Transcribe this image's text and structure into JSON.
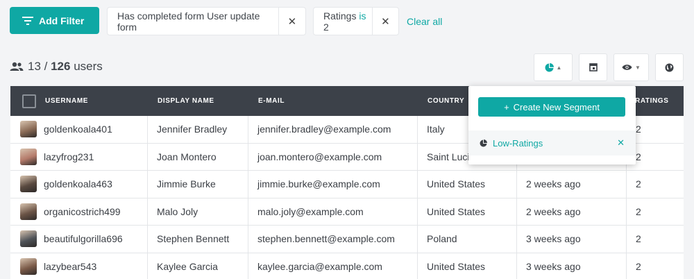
{
  "filters": {
    "add_filter_label": "Add Filter",
    "chips": [
      {
        "text_a": "Has completed form User update form",
        "hl": "",
        "text_b": ""
      },
      {
        "text_a": "Ratings ",
        "hl": "is",
        "text_b": " 2"
      }
    ],
    "clear_all_label": "Clear all"
  },
  "summary": {
    "shown": "13",
    "separator": " / ",
    "total": "126",
    "suffix": " users"
  },
  "toolbar": {
    "icons": [
      "segment-pie-icon",
      "columns-icon",
      "eye-icon",
      "globe-icon"
    ]
  },
  "table": {
    "headers": [
      "USERNAME",
      "DISPLAY NAME",
      "E-MAIL",
      "COUNTRY",
      "",
      "RATINGS"
    ],
    "rows": [
      {
        "username": "goldenkoala401",
        "display": "Jennifer Bradley",
        "email": "jennifer.bradley@example.com",
        "country": "Italy",
        "time": "",
        "rating": "2",
        "avatar": "#8a6a55"
      },
      {
        "username": "lazyfrog231",
        "display": "Joan Montero",
        "email": "joan.montero@example.com",
        "country": "Saint Lucia",
        "time": "",
        "rating": "2",
        "avatar": "#b47a6a"
      },
      {
        "username": "goldenkoala463",
        "display": "Jimmie Burke",
        "email": "jimmie.burke@example.com",
        "country": "United States",
        "time": "2 weeks ago",
        "rating": "2",
        "avatar": "#5a4a40"
      },
      {
        "username": "organicostrich499",
        "display": "Malo Joly",
        "email": "malo.joly@example.com",
        "country": "United States",
        "time": "2 weeks ago",
        "rating": "2",
        "avatar": "#6b5446"
      },
      {
        "username": "beautifulgorilla696",
        "display": "Stephen Bennett",
        "email": "stephen.bennett@example.com",
        "country": "Poland",
        "time": "3 weeks ago",
        "rating": "2",
        "avatar": "#4f5358"
      },
      {
        "username": "lazybear543",
        "display": "Kaylee Garcia",
        "email": "kaylee.garcia@example.com",
        "country": "United States",
        "time": "3 weeks ago",
        "rating": "2",
        "avatar": "#7a5a48"
      }
    ]
  },
  "segments_dropdown": {
    "create_label": "Create New Segment",
    "items": [
      {
        "label": "Low-Ratings"
      }
    ]
  },
  "colors": {
    "accent": "#0fa8a4",
    "header_bg": "#3c4149"
  }
}
